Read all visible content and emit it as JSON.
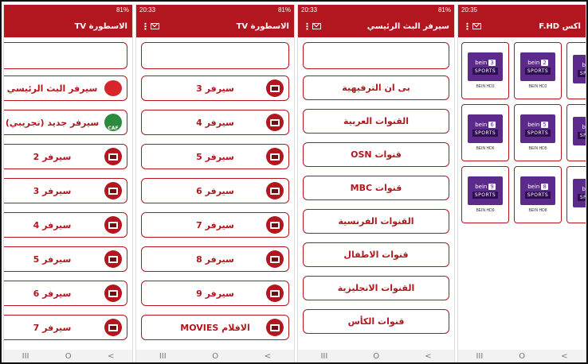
{
  "colors": {
    "accent": "#b2161e"
  },
  "phones": [
    {
      "status_time": "",
      "status_right": "81%",
      "title": "الاسطورة TV",
      "items": [
        {
          "label": "سيرفر البث الرئيسي",
          "icon": "red-logo-icon"
        },
        {
          "label": "سيرفر جديد (تجريبي)",
          "icon": "caf-logo-icon"
        },
        {
          "label": "سيرفر 2",
          "icon": "tv-icon"
        },
        {
          "label": "سيرفر 3",
          "icon": "tv-icon"
        },
        {
          "label": "سيرفر 4",
          "icon": "tv-icon"
        },
        {
          "label": "سيرفر 5",
          "icon": "tv-icon"
        },
        {
          "label": "سيرفر 6",
          "icon": "tv-icon"
        },
        {
          "label": "سيرفر 7",
          "icon": "tv-icon"
        }
      ]
    },
    {
      "status_time": "20:33",
      "status_right": "81%",
      "title": "الاسطورة TV",
      "items": [
        {
          "label": "سيرفر 3",
          "icon": "tv-icon"
        },
        {
          "label": "سيرفر 4",
          "icon": "tv-icon"
        },
        {
          "label": "سيرفر 5",
          "icon": "tv-icon"
        },
        {
          "label": "سيرفر 6",
          "icon": "tv-icon"
        },
        {
          "label": "سيرفر 7",
          "icon": "tv-icon"
        },
        {
          "label": "سيرفر 8",
          "icon": "tv-icon"
        },
        {
          "label": "سيرفر 9",
          "icon": "tv-icon"
        },
        {
          "label": "الافلام MOVIES",
          "icon": "tv-icon"
        }
      ]
    },
    {
      "status_time": "20:33",
      "status_right": "81%",
      "title": "سيرفر البث الرئيسي",
      "items": [
        {
          "label": "بى ان الترفيهية"
        },
        {
          "label": "القنوات العربية"
        },
        {
          "label": "قنوات OSN"
        },
        {
          "label": "قنوات MBC"
        },
        {
          "label": "القنوات الفرنسية"
        },
        {
          "label": "قنوات الاطفال"
        },
        {
          "label": "القنوات الانجليزية"
        },
        {
          "label": "قنوات الكأس"
        }
      ]
    },
    {
      "status_time": "20:35",
      "status_right": "",
      "title": "اكس F.HD",
      "cards": [
        {
          "num": "3",
          "caption": "BEIN HD3"
        },
        {
          "num": "2",
          "caption": "BEIN HD2"
        },
        {
          "num": "",
          "caption": ""
        },
        {
          "num": "6",
          "caption": "BEIN HD6"
        },
        {
          "num": "5",
          "caption": "BEIN HD5"
        },
        {
          "num": "",
          "caption": ""
        },
        {
          "num": "9",
          "caption": "BEIN HD9"
        },
        {
          "num": "8",
          "caption": "BEIN HD8"
        },
        {
          "num": "",
          "caption": ""
        }
      ]
    }
  ],
  "bein_brand": "bein",
  "bein_sports": "SPORTS",
  "nav": {
    "recent": "III",
    "home": "O",
    "back": "<"
  }
}
